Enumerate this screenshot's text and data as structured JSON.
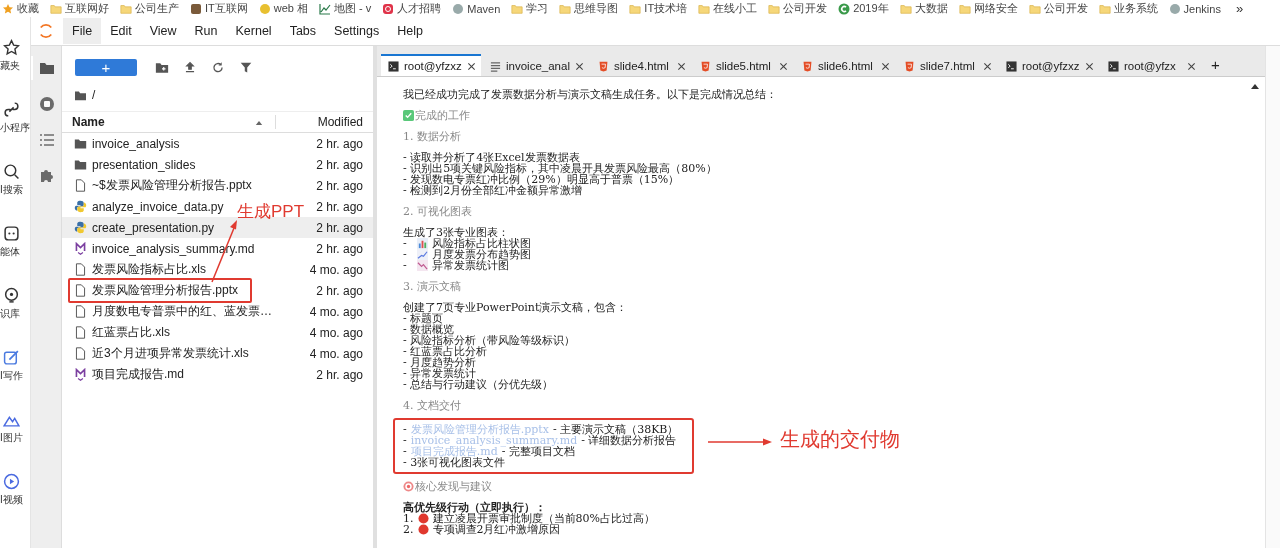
{
  "bookmarks": [
    {
      "kind": "star",
      "label": "收藏"
    },
    {
      "kind": "folder",
      "label": "互联网好"
    },
    {
      "kind": "folder",
      "label": "公司生产"
    },
    {
      "kind": "site",
      "label": "IT互联网"
    },
    {
      "kind": "web",
      "label": "web 相"
    },
    {
      "kind": "chart",
      "label": "地图 - v"
    },
    {
      "kind": "app",
      "label": "人才招聘"
    },
    {
      "kind": "globe",
      "label": "Maven"
    },
    {
      "kind": "folder",
      "label": "学习"
    },
    {
      "kind": "folder",
      "label": "思维导图"
    },
    {
      "kind": "folder",
      "label": "IT技术培"
    },
    {
      "kind": "folder",
      "label": "在线小工"
    },
    {
      "kind": "folder",
      "label": "公司开发"
    },
    {
      "kind": "c",
      "label": "2019年"
    },
    {
      "kind": "folder",
      "label": "大数据"
    },
    {
      "kind": "folder",
      "label": "网络安全"
    },
    {
      "kind": "folder",
      "label": "公司开发"
    },
    {
      "kind": "folder",
      "label": "业务系统"
    },
    {
      "kind": "globe",
      "label": "Jenkins"
    }
  ],
  "bookmarks_more": "»",
  "browser_sidebar": [
    {
      "kind": "star",
      "label": "藏夹"
    },
    {
      "kind": "link",
      "label": "小程序"
    },
    {
      "kind": "search",
      "label": "I搜索"
    },
    {
      "kind": "bot",
      "label": "能体"
    },
    {
      "kind": "bulb",
      "label": "识库"
    },
    {
      "kind": "pen",
      "label": "I写作"
    },
    {
      "kind": "image",
      "label": "I图片"
    },
    {
      "kind": "video",
      "label": "I视频"
    }
  ],
  "menu": [
    {
      "label": "File",
      "selected": true
    },
    {
      "label": "Edit",
      "selected": false
    },
    {
      "label": "View",
      "selected": false
    },
    {
      "label": "Run",
      "selected": false
    },
    {
      "label": "Kernel",
      "selected": false
    },
    {
      "label": "Tabs",
      "selected": false
    },
    {
      "label": "Settings",
      "selected": false
    },
    {
      "label": "Help",
      "selected": false
    }
  ],
  "activity_bar": [
    {
      "kind": "folder",
      "selected": true
    },
    {
      "kind": "running",
      "selected": false
    },
    {
      "kind": "toc",
      "selected": false
    },
    {
      "kind": "extensions",
      "selected": false
    }
  ],
  "file_browser": {
    "new_button": "+",
    "breadcrumb": "/",
    "columns": [
      "Name",
      "Modified"
    ],
    "rows": [
      {
        "kind": "folder",
        "name": "invoice_analysis",
        "modified": "2 hr. ago",
        "selected": false,
        "annotated": false
      },
      {
        "kind": "folder",
        "name": "presentation_slides",
        "modified": "2 hr. ago",
        "selected": false,
        "annotated": false
      },
      {
        "kind": "file",
        "name": "~$发票风险管理分析报告.pptx",
        "modified": "2 hr. ago",
        "selected": false,
        "annotated": false
      },
      {
        "kind": "python",
        "name": "analyze_invoice_data.py",
        "modified": "2 hr. ago",
        "selected": false,
        "annotated": false
      },
      {
        "kind": "python",
        "name": "create_presentation.py",
        "modified": "2 hr. ago",
        "selected": true,
        "annotated": false
      },
      {
        "kind": "markdown",
        "name": "invoice_analysis_summary.md",
        "modified": "2 hr. ago",
        "selected": false,
        "annotated": false
      },
      {
        "kind": "file",
        "name": "发票风险指标占比.xls",
        "modified": "4 mo. ago",
        "selected": false,
        "annotated": false
      },
      {
        "kind": "file",
        "name": "发票风险管理分析报告.pptx",
        "modified": "2 hr. ago",
        "selected": false,
        "annotated": true
      },
      {
        "kind": "file",
        "name": "月度数电专普票中的红、蓝发票…",
        "modified": "4 mo. ago",
        "selected": false,
        "annotated": false
      },
      {
        "kind": "file",
        "name": "红蓝票占比.xls",
        "modified": "4 mo. ago",
        "selected": false,
        "annotated": false
      },
      {
        "kind": "file",
        "name": "近3个月进项异常发票统计.xls",
        "modified": "4 mo. ago",
        "selected": false,
        "annotated": false
      },
      {
        "kind": "markdown",
        "name": "项目完成报告.md",
        "modified": "2 hr. ago",
        "selected": false,
        "annotated": false
      }
    ],
    "annotation": "生成PPT"
  },
  "tabs": [
    {
      "kind": "terminal",
      "label": "root@yfzxz",
      "selected": true
    },
    {
      "kind": "text",
      "label": "invoice_anal",
      "selected": false
    },
    {
      "kind": "html",
      "label": "slide4.html",
      "selected": false
    },
    {
      "kind": "html",
      "label": "slide5.html",
      "selected": false
    },
    {
      "kind": "html",
      "label": "slide6.html",
      "selected": false
    },
    {
      "kind": "html",
      "label": "slide7.html",
      "selected": false
    },
    {
      "kind": "terminal",
      "label": "root@yfzxz",
      "selected": false
    },
    {
      "kind": "terminal",
      "label": "root@yfzx",
      "selected": false
    }
  ],
  "new_tab": "+",
  "content": {
    "blocks": [
      {
        "kind": "para",
        "annotated": false,
        "lines": [
          {
            "kind": "text",
            "text": "我已经成功完成了发票数据分析与演示文稿生成任务。以下是完成情况总结："
          }
        ]
      },
      {
        "kind": "check-heading",
        "text": "完成的工作"
      },
      {
        "kind": "heading",
        "text": "1. 数据分析"
      },
      {
        "kind": "para",
        "annotated": false,
        "lines": [
          {
            "kind": "text",
            "text": "- 读取并分析了4张Excel发票数据表"
          },
          {
            "kind": "text",
            "text": "- 识别出5项关键风险指标，其中凌晨开具发票风险最高（80%）"
          },
          {
            "kind": "text",
            "text": "- 发现数电专票红冲比例（29%）明显高于普票（15%）"
          },
          {
            "kind": "text",
            "text": "- 检测到2月份全部红冲金额异常激增"
          }
        ]
      },
      {
        "kind": "heading",
        "text": "2. 可视化图表"
      },
      {
        "kind": "para",
        "annotated": false,
        "lines": [
          {
            "kind": "text",
            "text": "生成了3张专业图表："
          },
          {
            "kind": "bar-item",
            "bullet": "-",
            "text": "风险指标占比柱状图"
          },
          {
            "kind": "trend-item",
            "bullet": "-",
            "text": "月度发票分布趋势图"
          },
          {
            "kind": "stats-item",
            "bullet": "-",
            "text": "异常发票统计图"
          }
        ]
      },
      {
        "kind": "heading",
        "text": "3. 演示文稿"
      },
      {
        "kind": "para",
        "annotated": false,
        "lines": [
          {
            "kind": "text",
            "text": "创建了7页专业PowerPoint演示文稿，包含："
          },
          {
            "kind": "text",
            "text": "- 标题页"
          },
          {
            "kind": "text",
            "text": "- 数据概览"
          },
          {
            "kind": "text",
            "text": "- 风险指标分析（带风险等级标识）"
          },
          {
            "kind": "text",
            "text": "- 红蓝票占比分析"
          },
          {
            "kind": "text",
            "text": "- 月度趋势分析"
          },
          {
            "kind": "text",
            "text": "- 异常发票统计"
          },
          {
            "kind": "text",
            "text": "- 总结与行动建议（分优先级）"
          }
        ]
      },
      {
        "kind": "heading",
        "text": "4. 文档交付"
      },
      {
        "kind": "para",
        "annotated": true,
        "annotation": "生成的交付物",
        "lines": [
          {
            "kind": "link-item",
            "bullet": "-",
            "link": "发票风险管理分析报告.pptx",
            "text": "- 主要演示文稿（38KB）"
          },
          {
            "kind": "link-item",
            "bullet": "-",
            "link": "invoice_analysis_summary.md",
            "text": "- 详细数据分析报告"
          },
          {
            "kind": "link-item",
            "bullet": "-",
            "link": "项目完成报告.md",
            "text": "- 完整项目文档"
          },
          {
            "kind": "text",
            "text": "- 3张可视化图表文件"
          }
        ]
      },
      {
        "kind": "target-heading",
        "text": "核心发现与建议"
      },
      {
        "kind": "para",
        "annotated": false,
        "lines": [
          {
            "kind": "bold",
            "text": "高优先级行动（立即执行）："
          },
          {
            "kind": "red-item",
            "bullet": "1.",
            "text": "建立凌晨开票审批制度（当前80%占比过高）"
          },
          {
            "kind": "red-item",
            "bullet": "2.",
            "text": "专项调查2月红冲激增原因"
          }
        ]
      }
    ]
  }
}
